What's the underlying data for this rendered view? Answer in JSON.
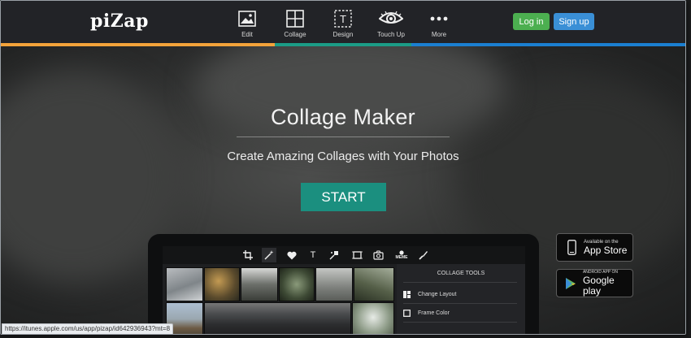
{
  "brand": {
    "logo": "piZap"
  },
  "nav": {
    "items": [
      {
        "label": "Edit",
        "icon": "image-icon"
      },
      {
        "label": "Collage",
        "icon": "collage-grid-icon"
      },
      {
        "label": "Design",
        "icon": "text-frame-icon"
      },
      {
        "label": "Touch Up",
        "icon": "eye-icon"
      },
      {
        "label": "More",
        "icon": "more-dots-icon"
      }
    ],
    "login": "Log in",
    "signup": "Sign up"
  },
  "colors": {
    "nav_bg": "#222327",
    "stripe": [
      "#f3a33a",
      "#f3a33a",
      "#1b9c86",
      "#1b7fd1",
      "#1b7fd1"
    ],
    "login": "#4caf50",
    "signup": "#3a8fd6",
    "start": "#1b8f7f"
  },
  "hero": {
    "title": "Collage Maker",
    "subtitle": "Create Amazing Collages with Your Photos",
    "cta": "START"
  },
  "app_preview": {
    "tools": [
      "crop-icon",
      "magic-wand-icon",
      "heart-icon",
      "text-icon",
      "paint-icon",
      "frame-icon",
      "photo-icon",
      "meme-icon",
      "brush-icon"
    ],
    "meme_label": "MEME",
    "tool_text": "T",
    "panel_title": "COLLAGE TOOLS",
    "panel_items": [
      {
        "label": "Change Layout",
        "icon": "layout-icon"
      },
      {
        "label": "Frame Color",
        "icon": "square-icon"
      }
    ]
  },
  "stores": {
    "apple": {
      "small": "Available on the",
      "big": "App Store"
    },
    "google": {
      "small": "ANDROID APP ON",
      "big": "Google play"
    }
  },
  "status_url": "https://itunes.apple.com/us/app/pizap/id642936943?mt=8"
}
